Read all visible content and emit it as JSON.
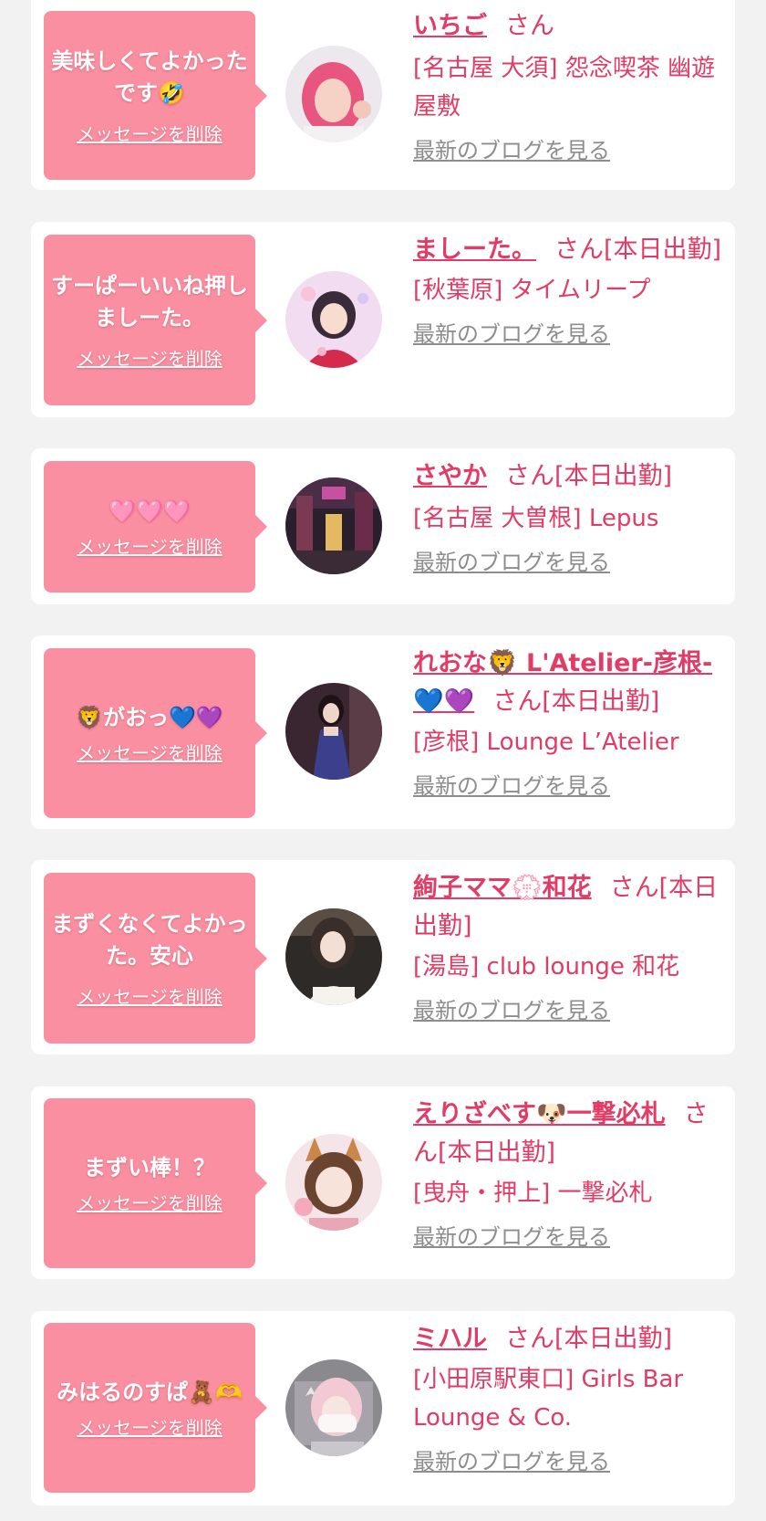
{
  "delete_label": "メッセージを削除",
  "blog_label": "最新のブログを見る",
  "colors": {
    "page_bg": "#f2f2f2",
    "card_bg": "#ffffff",
    "bubble_bg": "#fa8fa1",
    "accent_text": "#e13b66",
    "link_gray": "#8d8d8d"
  },
  "entries": [
    {
      "message": "美味しくてよかったです🤣",
      "name": "いちご",
      "suffix": "さん",
      "shop": "[名古屋 大須] 怨念喫茶 幽遊屋敷",
      "avatar_icon": "pink-hair-girl-avatar"
    },
    {
      "message": "すーぱーいいね押しましーた。",
      "name": "ましーた。",
      "suffix": "さん[本日出勤]",
      "shop": "[秋葉原] タイムリープ",
      "avatar_icon": "kimono-girl-avatar"
    },
    {
      "message": "🩷🩷🩷",
      "name": "さやか",
      "suffix": "さん[本日出勤]",
      "shop": "[名古屋 大曽根] Lepus",
      "avatar_icon": "night-street-avatar"
    },
    {
      "message": "🦁がおっ💙💜",
      "name": "れおな🦁 L'Atelier-彦根-💙💜",
      "suffix": "さん[本日出勤]",
      "shop": "[彦根] Lounge L’Atelier",
      "avatar_icon": "dress-woman-avatar"
    },
    {
      "message": "まずくなくてよかった。安心",
      "name": "絢子ママ💮和花",
      "suffix": "さん[本日出勤]",
      "shop": "[湯島] club lounge 和花",
      "avatar_icon": "lounge-woman-avatar"
    },
    {
      "message": "まずい棒！？",
      "name": "えりざべす🐶一撃必札",
      "suffix": "さん[本日出勤]",
      "shop": "[曳舟・押上] 一撃必札",
      "avatar_icon": "animal-ears-girl-avatar"
    },
    {
      "message": "みはるのすぱ🧸🫶",
      "name": "ミハル",
      "suffix": "さん[本日出勤]",
      "shop": "[小田原駅東口] Girls Bar Lounge & Co.",
      "avatar_icon": "covered-face-girl-avatar"
    }
  ]
}
